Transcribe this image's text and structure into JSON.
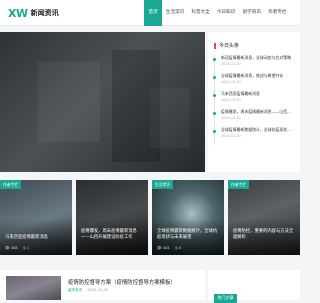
{
  "header": {
    "logo_mark": "XW",
    "logo_text": "新闻资讯",
    "nav": [
      "首页",
      "生活常识",
      "科普大全",
      "今日知识",
      "留学资讯",
      "作者专栏"
    ]
  },
  "sidebar": {
    "heading": "今日头条",
    "items": [
      {
        "title": "新冠疫情最新消息，全球动态与应对策略",
        "date": "2024-12-30"
      },
      {
        "title": "全球疫情最新消息，挑战与希望并存",
        "date": "2024-12-30"
      },
      {
        "title": "马来西亚疫情最新消息",
        "date": "2024-12-30"
      },
      {
        "title": "疫情爆发，周末疫情最新消息——山西开展建",
        "date": "2024-12-30"
      },
      {
        "title": "全球疫情最新数据统计，全球抗疫现状与未来",
        "date": "2024-12-30"
      }
    ],
    "bottom_tag": "热门文章"
  },
  "cards": [
    {
      "tag": "作者专栏",
      "title": "马来西亚疫情最新消息",
      "views": "348",
      "date": "1"
    },
    {
      "tag": "",
      "title": "疫情爆发，周末疫情最新消息——山西开展建设防疫工作",
      "views": "",
      "date": ""
    },
    {
      "tag": "生活常识",
      "title": "全球疫情最新数据统计，全球抗疫现状与未来展望",
      "views": "344",
      "date": "0"
    },
    {
      "tag": "作者专栏",
      "title": "疫情防控，重要的内容与方法全面解析",
      "views": "",
      "date": ""
    }
  ],
  "article": {
    "title": "疫情防控督导方案（疫情防控督导方案模板）",
    "category": "留学资讯",
    "date": "2024-12-30"
  }
}
